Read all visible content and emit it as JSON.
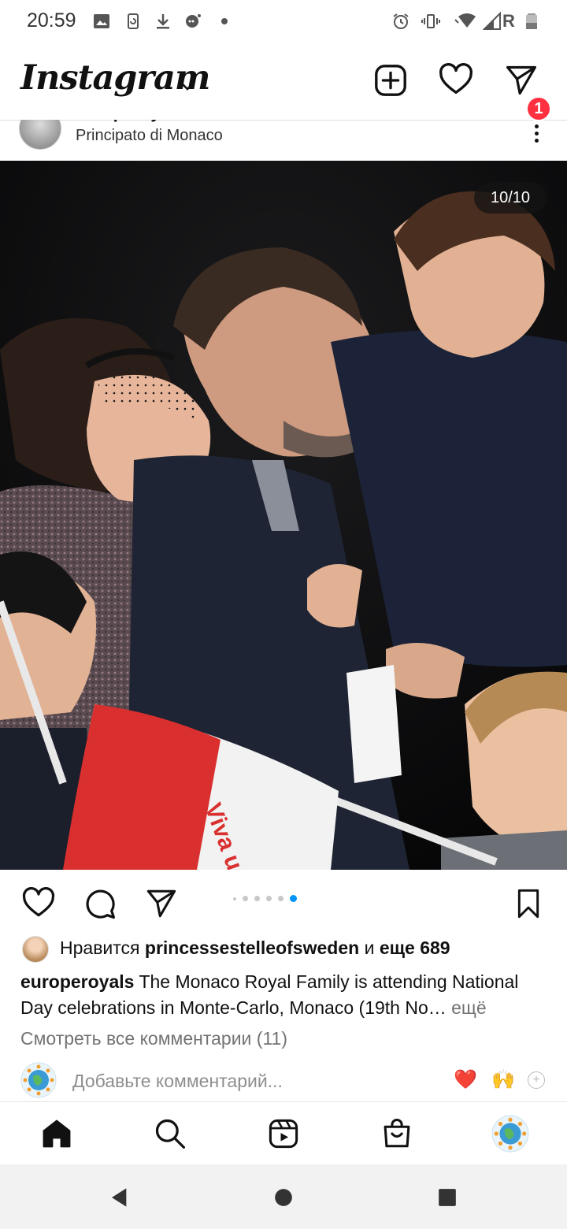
{
  "status_bar": {
    "time": "20:59",
    "left_icons": [
      "image-icon",
      "screen-rotation-icon",
      "download-icon",
      "chat-bubble-icon",
      "dot-icon"
    ],
    "right_icons": [
      "alarm-icon",
      "vibrate-icon",
      "wifi-icon",
      "signal-icon",
      "battery-icon"
    ],
    "roaming_label": "R"
  },
  "header": {
    "logo_text": "Instagram",
    "notification_count": "1"
  },
  "post": {
    "username": "europeroyals",
    "location": "Principato di Monaco",
    "image_counter": "10/10",
    "carousel_dots": 6,
    "carousel_active_index": 5,
    "likes": {
      "prefix": "Нравится",
      "liker": "princessestelleofsweden",
      "conjunction": "и",
      "others": "еще 689"
    },
    "caption": {
      "username": "europeroyals",
      "text": "The Monaco Royal Family is attending National Day celebrations in Monte-Carlo, Monaco (19th No…",
      "more": "ещё"
    },
    "view_comments": "Смотреть все комментарии (11)",
    "comment_placeholder": "Добавьте комментарий...",
    "quick_reactions": [
      "❤️",
      "🙌"
    ],
    "flag_text": "Viva u Prinç"
  },
  "colors": {
    "accent": "#0095f6",
    "badge": "#ff3040",
    "muted": "#737373"
  },
  "bottom_nav": [
    "home-icon",
    "search-icon",
    "reels-icon",
    "shop-icon",
    "profile-avatar"
  ],
  "system_nav": [
    "back-button",
    "home-button",
    "recents-button"
  ]
}
